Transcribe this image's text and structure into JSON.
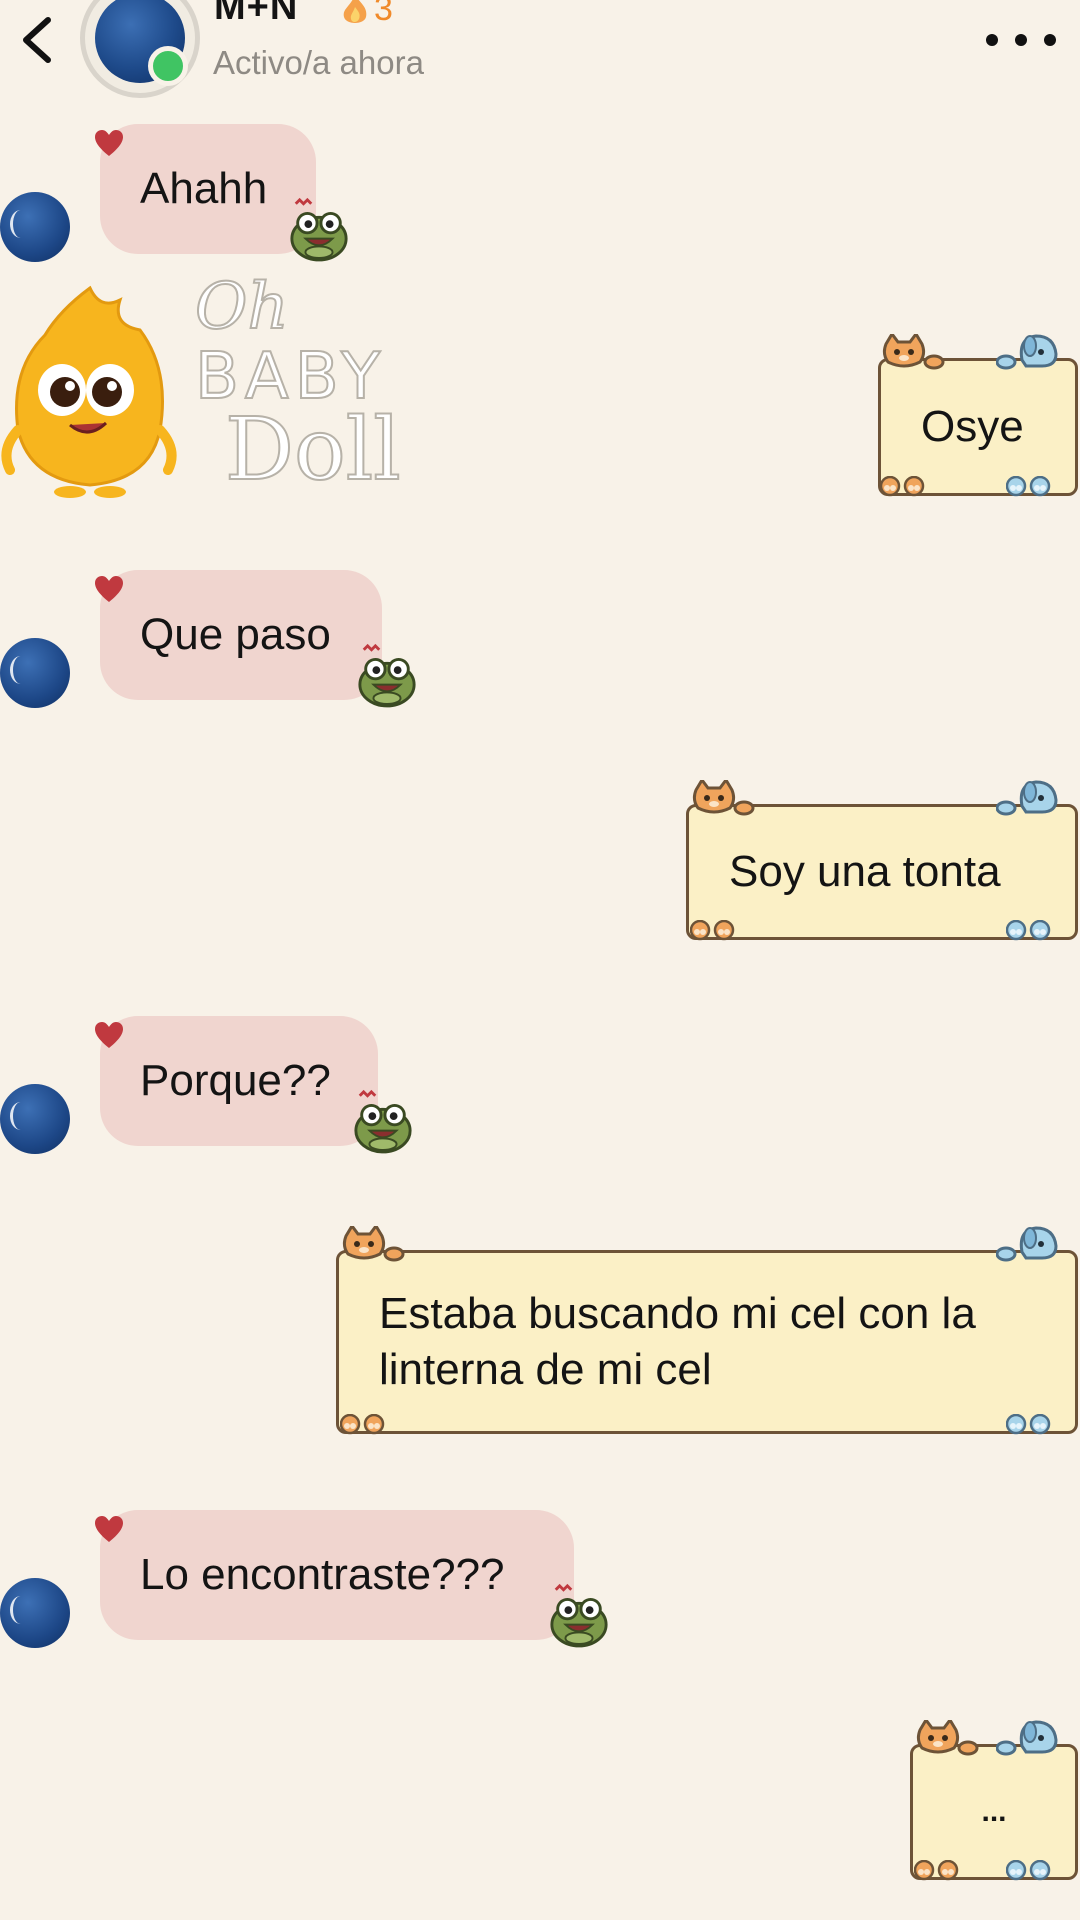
{
  "header": {
    "contact_name": "M+N",
    "streak_count": "3",
    "status": "Activo/a ahora",
    "icons": [
      "chevron-left-icon",
      "fire-icon",
      "more-dots-icon"
    ]
  },
  "sticker": {
    "text_line1": "Oh",
    "text_line2": "BABY",
    "text_line3": "Doll"
  },
  "messages": [
    {
      "from": "them",
      "text": "Ahahh"
    },
    {
      "from": "me",
      "text": "Osye"
    },
    {
      "from": "them",
      "text": "Que paso"
    },
    {
      "from": "me",
      "text": "Soy una tonta"
    },
    {
      "from": "them",
      "text": "Porque??"
    },
    {
      "from": "me",
      "text_line1": "Estaba buscando mi cel con la",
      "text_line2": "linterna de mi cel"
    },
    {
      "from": "them",
      "text": "Lo encontraste???"
    },
    {
      "from": "me",
      "text": "..."
    }
  ],
  "colors": {
    "background": "#f8f2e8",
    "received_bubble": "#f0d5cf",
    "sent_card": "#fbf0c6",
    "sent_border": "#6d5337",
    "online": "#40c463",
    "streak": "#f08a2a"
  }
}
